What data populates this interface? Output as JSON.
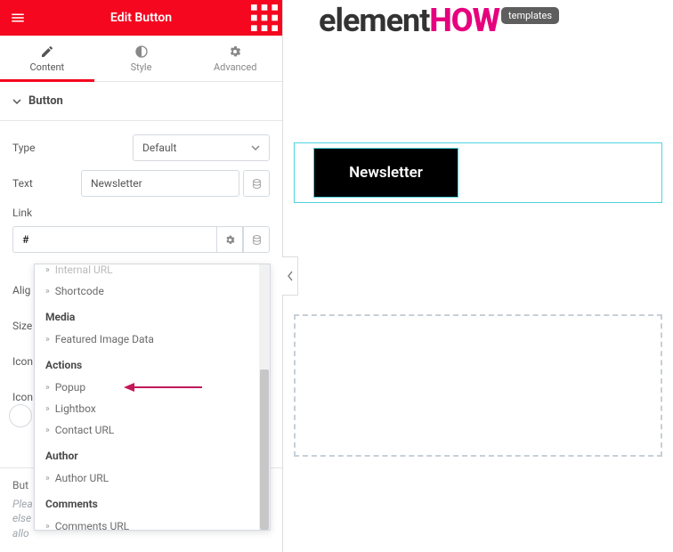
{
  "topbar": {
    "title": "Edit Button"
  },
  "tabs": {
    "content": "Content",
    "style": "Style",
    "advanced": "Advanced"
  },
  "section": {
    "title": "Button"
  },
  "fields": {
    "type": {
      "label": "Type",
      "value": "Default"
    },
    "text": {
      "label": "Text",
      "value": "Newsletter"
    },
    "link": {
      "label": "Link",
      "value": "#"
    },
    "align": "Alig",
    "size": "Size",
    "icon1": "Icon",
    "icon2": "Icon"
  },
  "dropdown": {
    "truncated_top": "Internal URL",
    "items_top": [
      "Shortcode"
    ],
    "cat_media": "Media",
    "media_items": [
      "Featured Image Data"
    ],
    "cat_actions": "Actions",
    "action_items": [
      "Popup",
      "Lightbox",
      "Contact URL"
    ],
    "cat_author": "Author",
    "author_items": [
      "Author URL"
    ],
    "cat_comments": "Comments",
    "comment_items": [
      "Comments URL"
    ]
  },
  "footer": {
    "button_id_label": "But",
    "help_line1": "Plea",
    "help_line2": "else",
    "help_line3": "allo"
  },
  "canvas": {
    "logo_part1": "element",
    "logo_part2": "HOW",
    "badge": "templates",
    "button_text": "Newsletter"
  }
}
